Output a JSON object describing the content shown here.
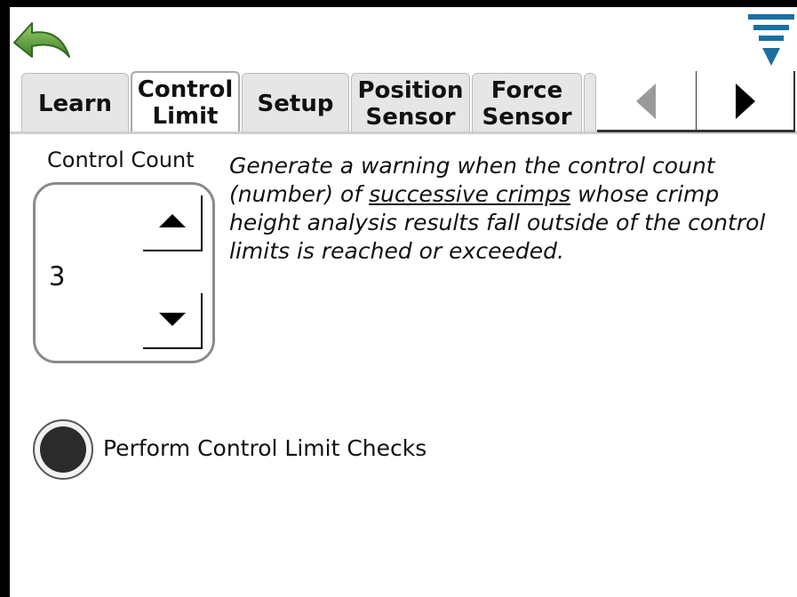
{
  "toolbar": {
    "back_icon": "back-arrow-icon",
    "menu_icon": "filter-menu-icon",
    "accent_green": "#5a9a3a",
    "accent_blue": "#1b6fa0"
  },
  "tabs": [
    {
      "label": "Learn",
      "active": false
    },
    {
      "label": "Control\nLimit",
      "active": true
    },
    {
      "label": "Setup",
      "active": false
    },
    {
      "label": "Position\nSensor",
      "active": false
    },
    {
      "label": "Force\nSensor",
      "active": false
    }
  ],
  "tab_scroll": {
    "left_icon": "triangle-left-icon",
    "right_icon": "triangle-right-icon",
    "left_enabled": false,
    "right_enabled": true
  },
  "control_count": {
    "label": "Control Count",
    "value": "3",
    "up_icon": "triangle-up-icon",
    "down_icon": "triangle-down-icon"
  },
  "description": {
    "part1": "Generate a warning when the control count (number) of ",
    "underlined": "successive crimps",
    "part2": " whose crimp height analysis results fall outside of the control limits is reached or exceeded."
  },
  "checks_toggle": {
    "label": "Perform Control Limit Checks",
    "checked": true
  }
}
